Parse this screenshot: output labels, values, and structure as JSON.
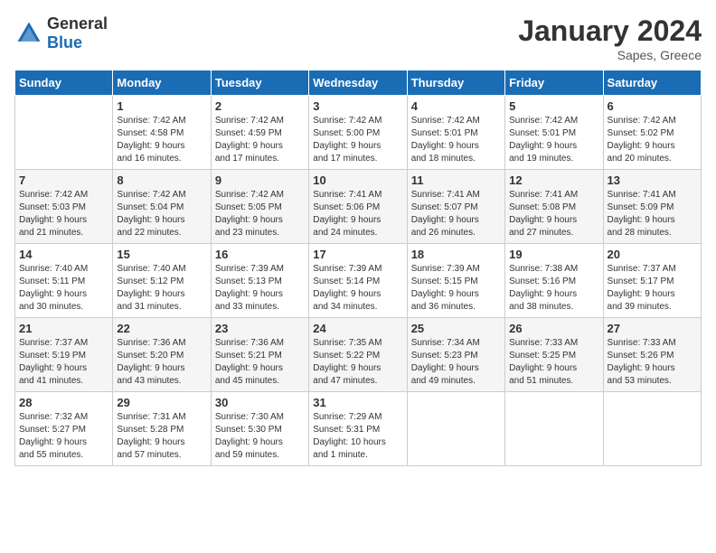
{
  "logo": {
    "general": "General",
    "blue": "Blue"
  },
  "title": "January 2024",
  "location": "Sapes, Greece",
  "days_header": [
    "Sunday",
    "Monday",
    "Tuesday",
    "Wednesday",
    "Thursday",
    "Friday",
    "Saturday"
  ],
  "weeks": [
    [
      {
        "day": "",
        "info": ""
      },
      {
        "day": "1",
        "info": "Sunrise: 7:42 AM\nSunset: 4:58 PM\nDaylight: 9 hours\nand 16 minutes."
      },
      {
        "day": "2",
        "info": "Sunrise: 7:42 AM\nSunset: 4:59 PM\nDaylight: 9 hours\nand 17 minutes."
      },
      {
        "day": "3",
        "info": "Sunrise: 7:42 AM\nSunset: 5:00 PM\nDaylight: 9 hours\nand 17 minutes."
      },
      {
        "day": "4",
        "info": "Sunrise: 7:42 AM\nSunset: 5:01 PM\nDaylight: 9 hours\nand 18 minutes."
      },
      {
        "day": "5",
        "info": "Sunrise: 7:42 AM\nSunset: 5:01 PM\nDaylight: 9 hours\nand 19 minutes."
      },
      {
        "day": "6",
        "info": "Sunrise: 7:42 AM\nSunset: 5:02 PM\nDaylight: 9 hours\nand 20 minutes."
      }
    ],
    [
      {
        "day": "7",
        "info": "Sunrise: 7:42 AM\nSunset: 5:03 PM\nDaylight: 9 hours\nand 21 minutes."
      },
      {
        "day": "8",
        "info": "Sunrise: 7:42 AM\nSunset: 5:04 PM\nDaylight: 9 hours\nand 22 minutes."
      },
      {
        "day": "9",
        "info": "Sunrise: 7:42 AM\nSunset: 5:05 PM\nDaylight: 9 hours\nand 23 minutes."
      },
      {
        "day": "10",
        "info": "Sunrise: 7:41 AM\nSunset: 5:06 PM\nDaylight: 9 hours\nand 24 minutes."
      },
      {
        "day": "11",
        "info": "Sunrise: 7:41 AM\nSunset: 5:07 PM\nDaylight: 9 hours\nand 26 minutes."
      },
      {
        "day": "12",
        "info": "Sunrise: 7:41 AM\nSunset: 5:08 PM\nDaylight: 9 hours\nand 27 minutes."
      },
      {
        "day": "13",
        "info": "Sunrise: 7:41 AM\nSunset: 5:09 PM\nDaylight: 9 hours\nand 28 minutes."
      }
    ],
    [
      {
        "day": "14",
        "info": "Sunrise: 7:40 AM\nSunset: 5:11 PM\nDaylight: 9 hours\nand 30 minutes."
      },
      {
        "day": "15",
        "info": "Sunrise: 7:40 AM\nSunset: 5:12 PM\nDaylight: 9 hours\nand 31 minutes."
      },
      {
        "day": "16",
        "info": "Sunrise: 7:39 AM\nSunset: 5:13 PM\nDaylight: 9 hours\nand 33 minutes."
      },
      {
        "day": "17",
        "info": "Sunrise: 7:39 AM\nSunset: 5:14 PM\nDaylight: 9 hours\nand 34 minutes."
      },
      {
        "day": "18",
        "info": "Sunrise: 7:39 AM\nSunset: 5:15 PM\nDaylight: 9 hours\nand 36 minutes."
      },
      {
        "day": "19",
        "info": "Sunrise: 7:38 AM\nSunset: 5:16 PM\nDaylight: 9 hours\nand 38 minutes."
      },
      {
        "day": "20",
        "info": "Sunrise: 7:37 AM\nSunset: 5:17 PM\nDaylight: 9 hours\nand 39 minutes."
      }
    ],
    [
      {
        "day": "21",
        "info": "Sunrise: 7:37 AM\nSunset: 5:19 PM\nDaylight: 9 hours\nand 41 minutes."
      },
      {
        "day": "22",
        "info": "Sunrise: 7:36 AM\nSunset: 5:20 PM\nDaylight: 9 hours\nand 43 minutes."
      },
      {
        "day": "23",
        "info": "Sunrise: 7:36 AM\nSunset: 5:21 PM\nDaylight: 9 hours\nand 45 minutes."
      },
      {
        "day": "24",
        "info": "Sunrise: 7:35 AM\nSunset: 5:22 PM\nDaylight: 9 hours\nand 47 minutes."
      },
      {
        "day": "25",
        "info": "Sunrise: 7:34 AM\nSunset: 5:23 PM\nDaylight: 9 hours\nand 49 minutes."
      },
      {
        "day": "26",
        "info": "Sunrise: 7:33 AM\nSunset: 5:25 PM\nDaylight: 9 hours\nand 51 minutes."
      },
      {
        "day": "27",
        "info": "Sunrise: 7:33 AM\nSunset: 5:26 PM\nDaylight: 9 hours\nand 53 minutes."
      }
    ],
    [
      {
        "day": "28",
        "info": "Sunrise: 7:32 AM\nSunset: 5:27 PM\nDaylight: 9 hours\nand 55 minutes."
      },
      {
        "day": "29",
        "info": "Sunrise: 7:31 AM\nSunset: 5:28 PM\nDaylight: 9 hours\nand 57 minutes."
      },
      {
        "day": "30",
        "info": "Sunrise: 7:30 AM\nSunset: 5:30 PM\nDaylight: 9 hours\nand 59 minutes."
      },
      {
        "day": "31",
        "info": "Sunrise: 7:29 AM\nSunset: 5:31 PM\nDaylight: 10 hours\nand 1 minute."
      },
      {
        "day": "",
        "info": ""
      },
      {
        "day": "",
        "info": ""
      },
      {
        "day": "",
        "info": ""
      }
    ]
  ]
}
